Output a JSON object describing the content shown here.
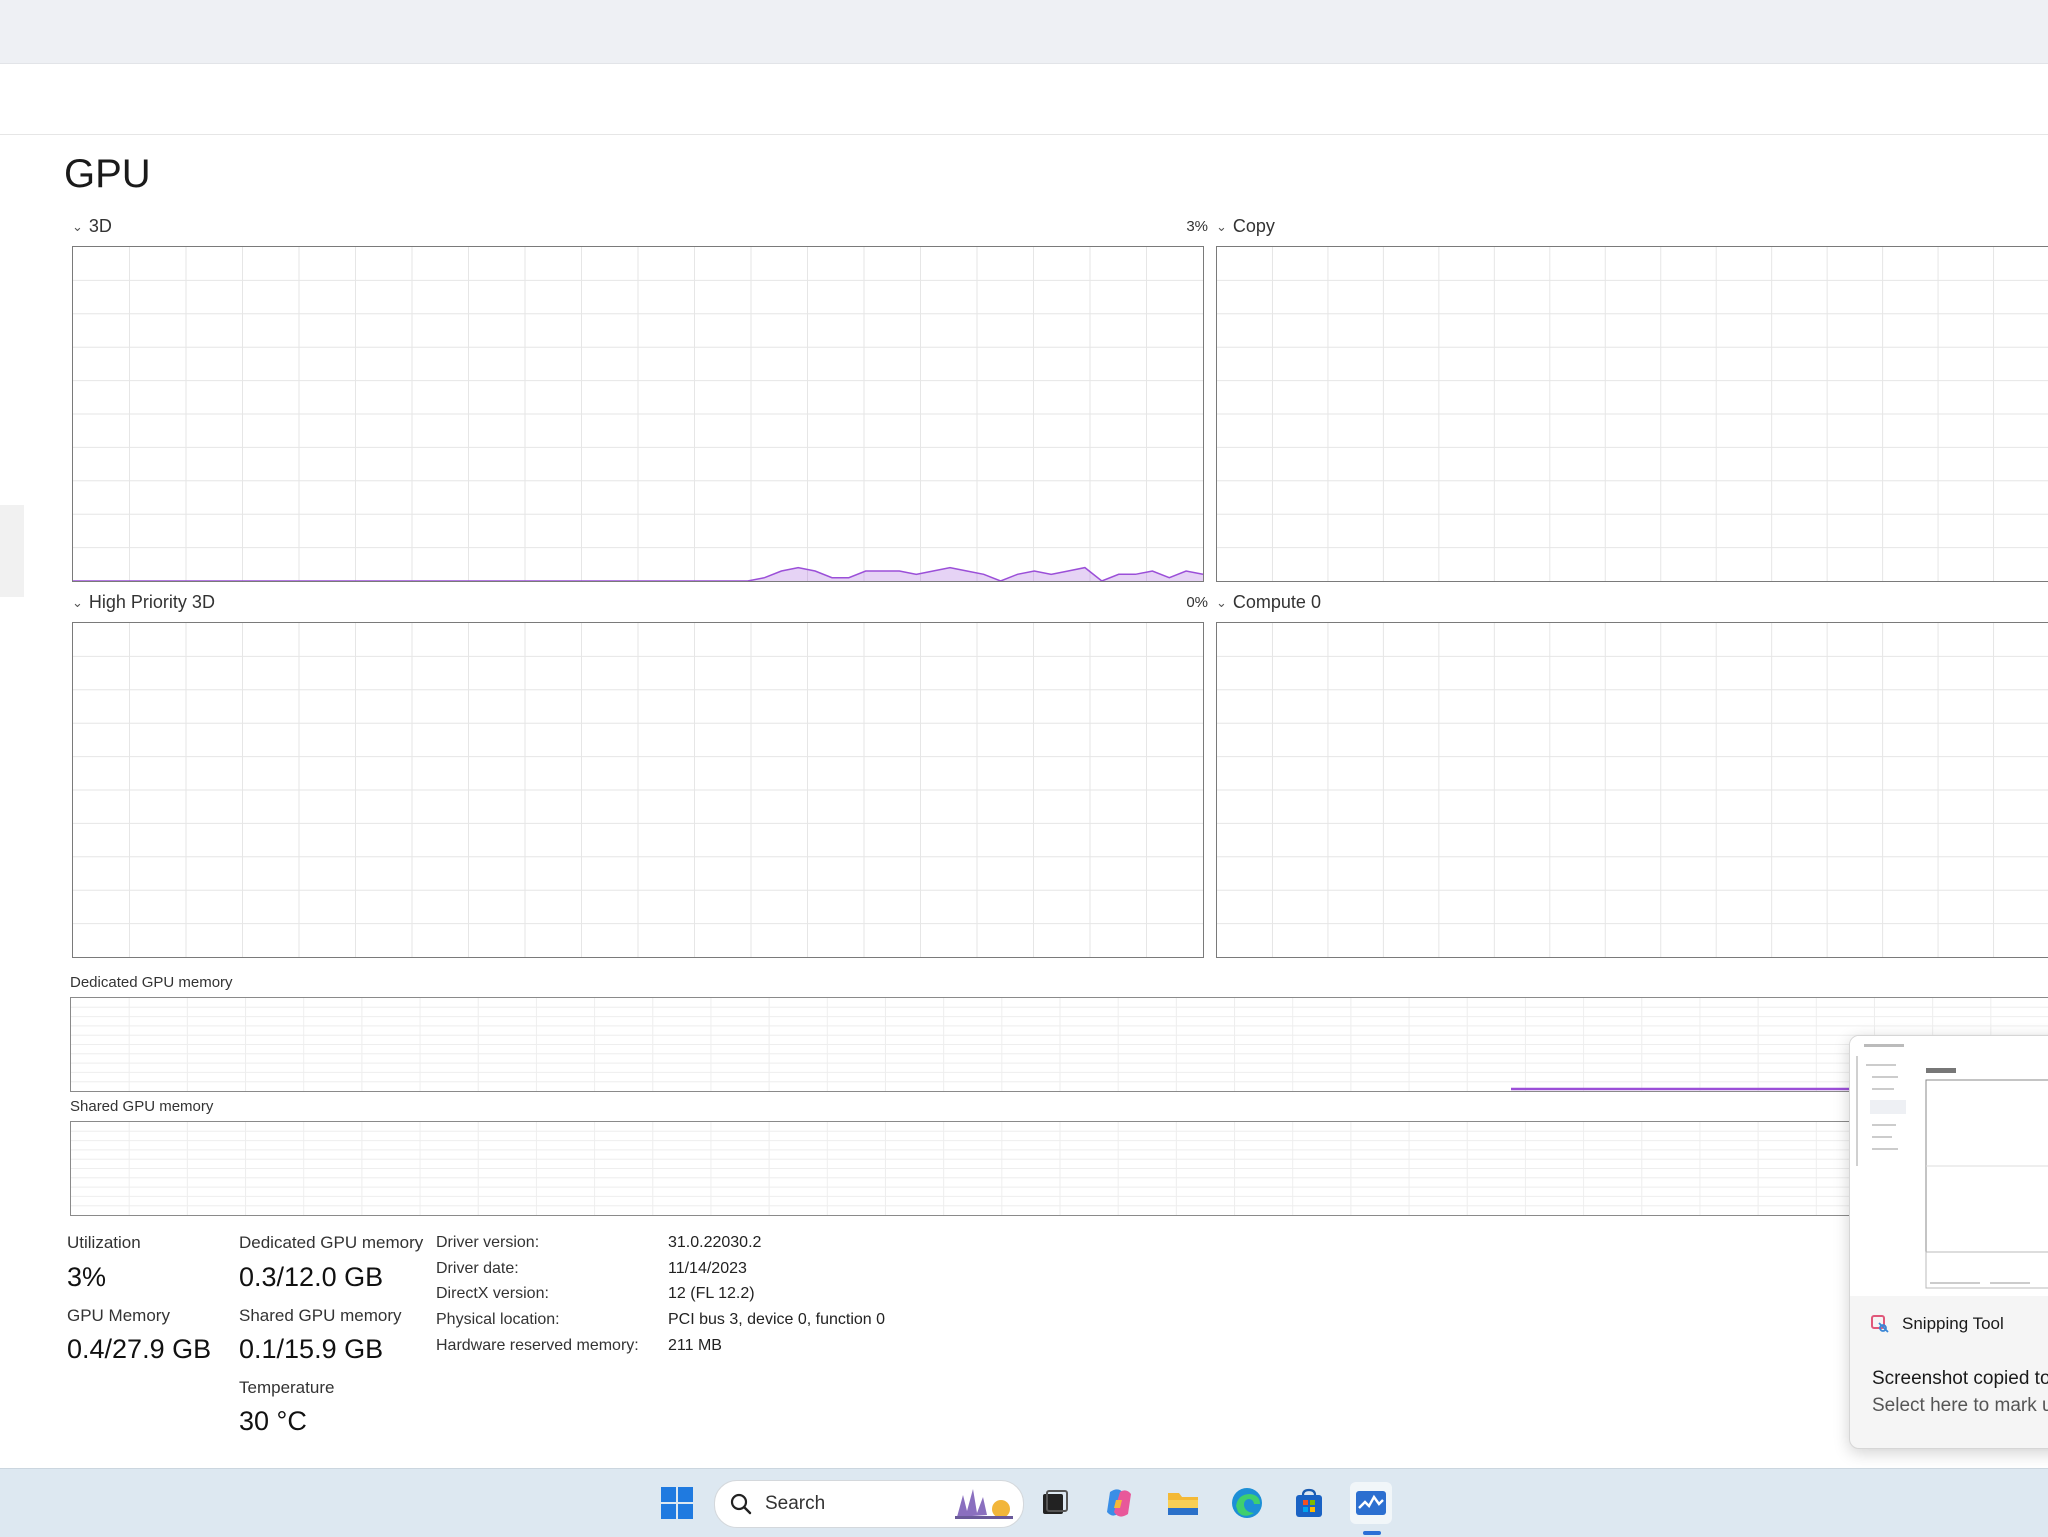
{
  "page": {
    "title": "GPU"
  },
  "graphs": {
    "g3d": {
      "label": "3D",
      "percent": "3%"
    },
    "copy": {
      "label": "Copy"
    },
    "hp3d": {
      "label": "High Priority 3D",
      "percent": "0%"
    },
    "compute0": {
      "label": "Compute 0"
    }
  },
  "chart_data": {
    "type": "area",
    "title": "3D",
    "ylim": [
      0,
      100
    ],
    "grid": true,
    "color": "#9b4fd8",
    "values": [
      0,
      0,
      0,
      0,
      0,
      0,
      0,
      0,
      0,
      0,
      0,
      0,
      0,
      0,
      0,
      0,
      0,
      0,
      0,
      0,
      0,
      0,
      0,
      0,
      0,
      0,
      0,
      0,
      0,
      0,
      0,
      0,
      0,
      0,
      0,
      0,
      0,
      0,
      0,
      0,
      0,
      1,
      3,
      4,
      3,
      1,
      1,
      3,
      3,
      3,
      2,
      3,
      4,
      3,
      2,
      0,
      2,
      3,
      2,
      3,
      4,
      0,
      2,
      2,
      3,
      1,
      3,
      2
    ]
  },
  "memory": {
    "dedicated_label": "Dedicated GPU memory",
    "shared_label": "Shared GPU memory"
  },
  "stats": {
    "utilization": {
      "label": "Utilization",
      "value": "3%"
    },
    "gpu_memory": {
      "label": "GPU Memory",
      "value": "0.4/27.9 GB"
    },
    "dedicated": {
      "label": "Dedicated GPU memory",
      "value": "0.3/12.0 GB"
    },
    "shared": {
      "label": "Shared GPU memory",
      "value": "0.1/15.9 GB"
    },
    "temperature": {
      "label": "Temperature",
      "value": "30 °C"
    }
  },
  "info": [
    {
      "k": "Driver version:",
      "v": "31.0.22030.2"
    },
    {
      "k": "Driver date:",
      "v": "11/14/2023"
    },
    {
      "k": "DirectX version:",
      "v": "12 (FL 12.2)"
    },
    {
      "k": "Physical location:",
      "v": "PCI bus 3, device 0, function 0"
    },
    {
      "k": "Hardware reserved memory:",
      "v": "211 MB"
    }
  ],
  "toast": {
    "app_name": "Snipping Tool",
    "message1": "Screenshot copied to clipboard",
    "message2": "Select here to mark up and share"
  },
  "taskbar": {
    "search_placeholder": "Search",
    "icons": [
      "start-icon",
      "widgets-icon",
      "task-view-icon",
      "copilot-icon",
      "file-explorer-icon",
      "edge-icon",
      "store-icon",
      "task-manager-icon"
    ]
  },
  "colors": {
    "accent": "#9b4fd8",
    "grid": "#e6e6e6",
    "taskbar": "#dde8f1"
  }
}
